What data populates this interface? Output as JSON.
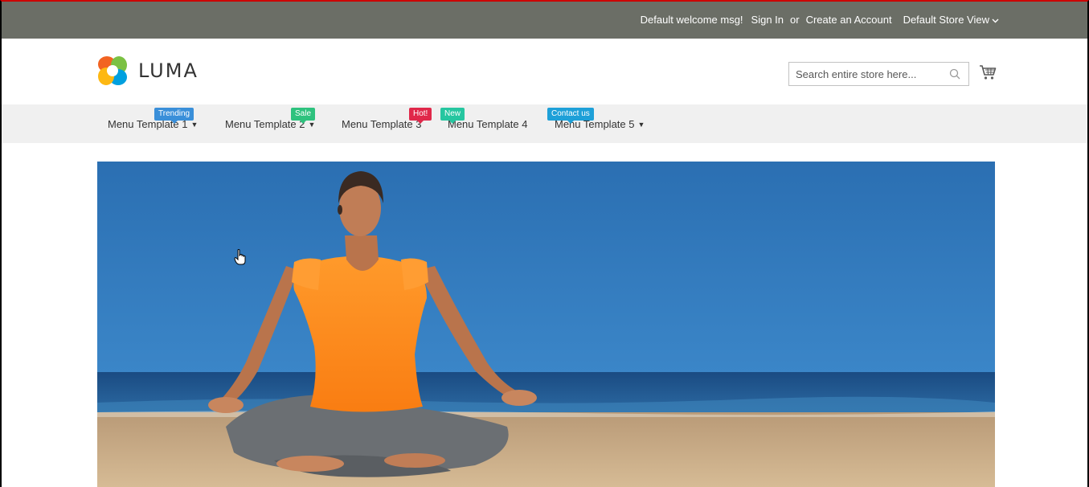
{
  "topbar": {
    "welcome": "Default welcome msg!",
    "sign_in": "Sign In",
    "or": "or",
    "create_account": "Create an Account",
    "store_view": "Default Store View"
  },
  "header": {
    "logo_text": "LUMA",
    "search_placeholder": "Search entire store here..."
  },
  "nav": {
    "items": [
      {
        "label": "Menu Template 1",
        "badge": "Trending",
        "badge_color": "#3a8fd9",
        "has_dropdown": true
      },
      {
        "label": "Menu Template 2",
        "badge": "Sale",
        "badge_color": "#2ec27e",
        "has_dropdown": true
      },
      {
        "label": "Menu Template 3",
        "badge": "Hot!",
        "badge_color": "#e0284a",
        "has_dropdown": false
      },
      {
        "label": "Menu Template 4",
        "badge": "New",
        "badge_color": "#26c6a0",
        "has_dropdown": false
      },
      {
        "label": "Menu Template 5",
        "badge": "Contact us",
        "badge_color": "#1ea0d8",
        "has_dropdown": true
      }
    ]
  },
  "colors": {
    "topbar_bg": "#6b6e66",
    "nav_bg": "#f0f0f0",
    "sky": "#2f74b8",
    "sea": "#1c4f86",
    "sand": "#c9ab86",
    "shirt": "#ff8c1a"
  },
  "hero": {
    "image": "woman-meditating-on-beach"
  }
}
